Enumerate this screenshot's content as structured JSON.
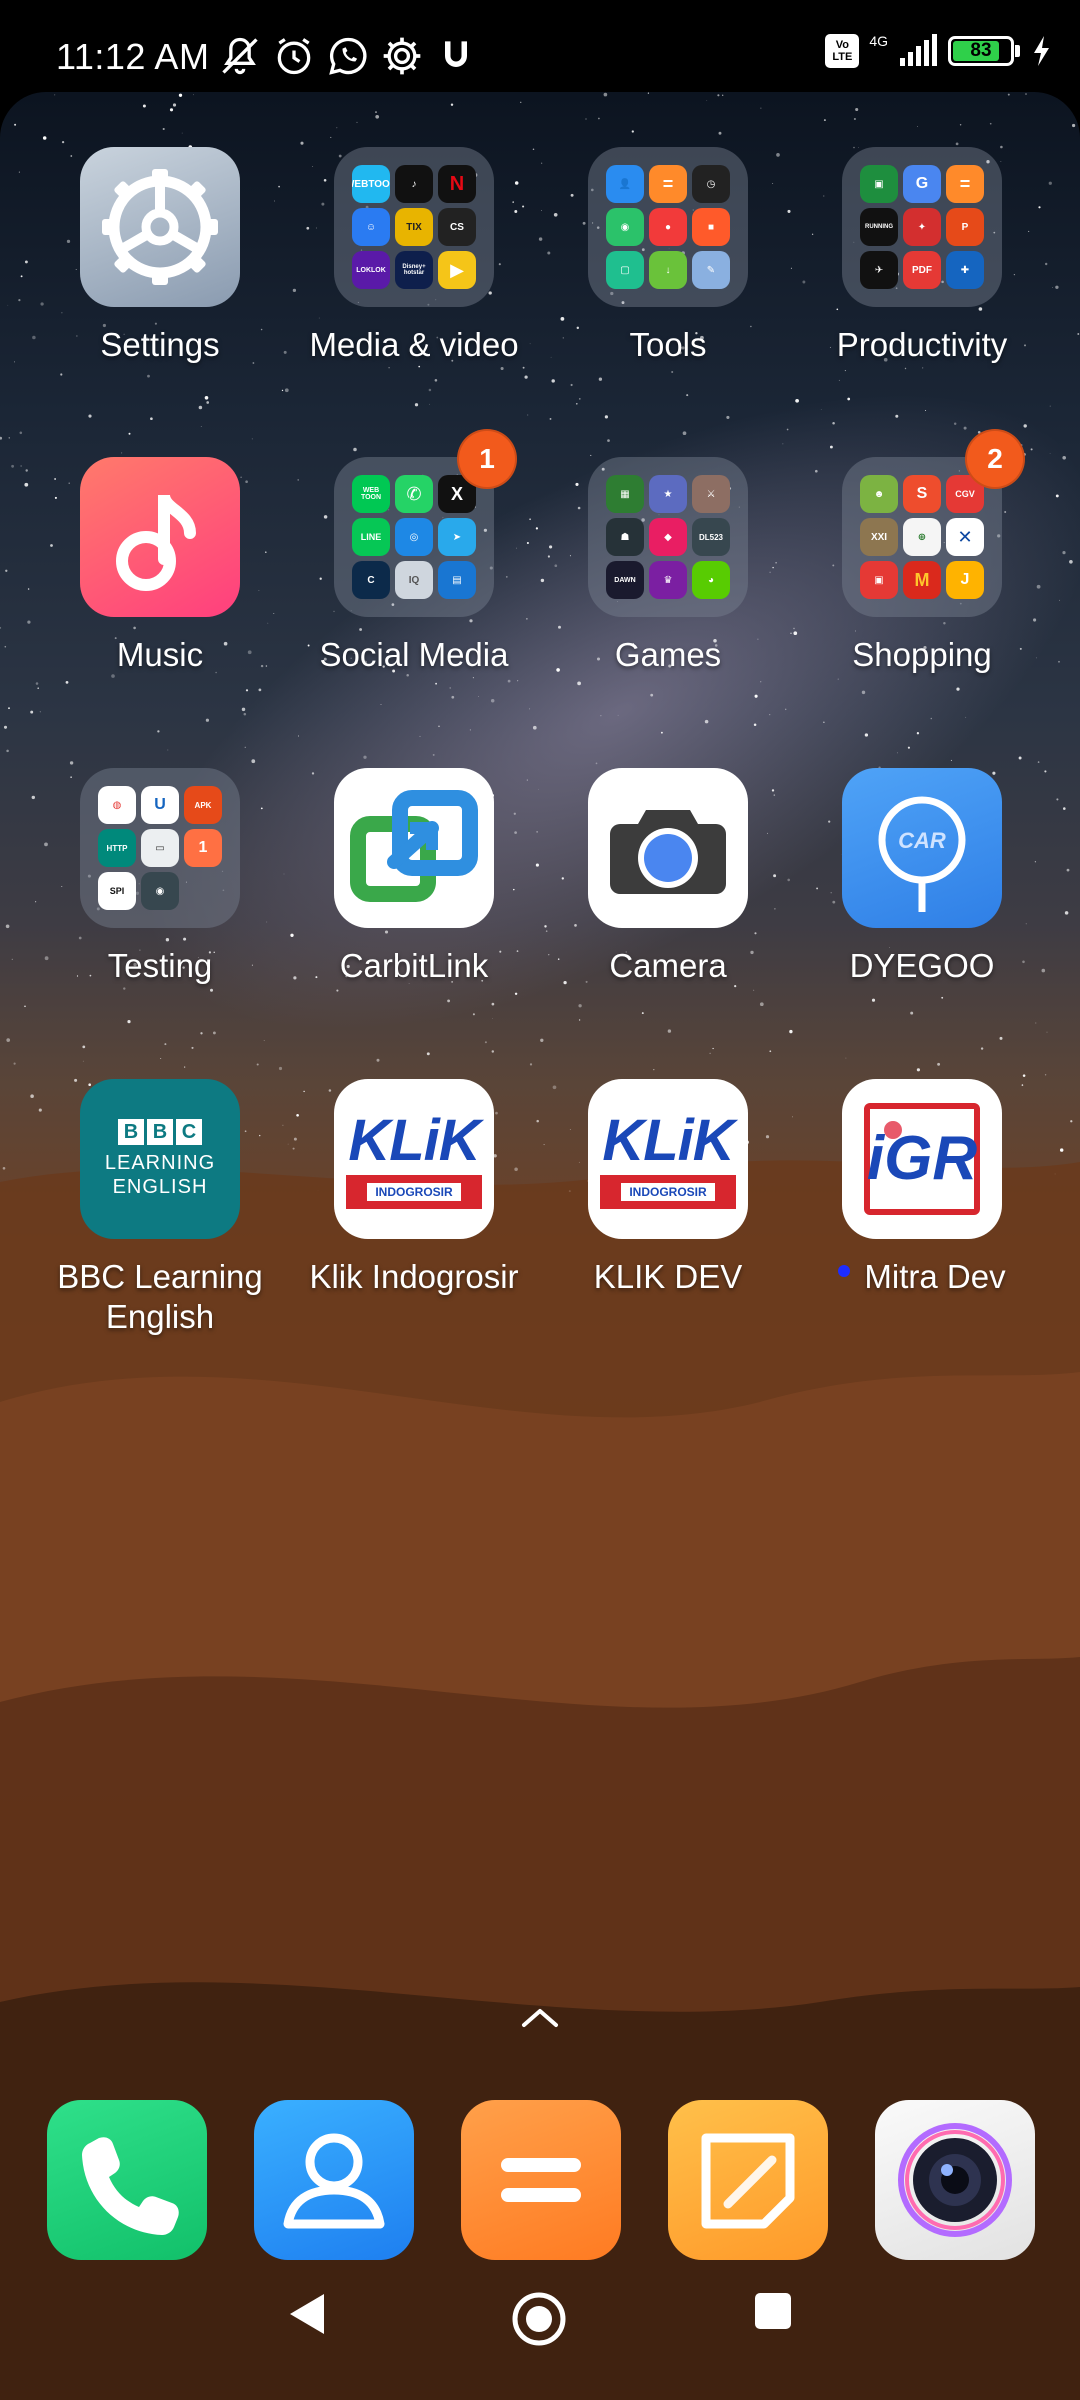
{
  "status_bar": {
    "time": "11:12 AM",
    "volte_line1": "Vo",
    "volte_line2": "LTE",
    "network": "4G",
    "battery_level": "83",
    "icons": [
      "mute-bell-icon",
      "alarm-icon",
      "whatsapp-icon",
      "gear-icon",
      "app-j-icon",
      "volte-icon",
      "signal-icon",
      "battery-icon",
      "charging-icon"
    ]
  },
  "home": {
    "row1": [
      {
        "label": "Settings",
        "icon": "settings-gear-icon"
      },
      {
        "label": "Media & video",
        "icon": "folder-icon"
      },
      {
        "label": "Tools",
        "icon": "folder-icon"
      },
      {
        "label": "Productivity",
        "icon": "folder-icon"
      }
    ],
    "row2": [
      {
        "label": "Music",
        "icon": "music-note-icon"
      },
      {
        "label": "Social Media",
        "icon": "folder-icon",
        "badge": "1"
      },
      {
        "label": "Games",
        "icon": "folder-icon"
      },
      {
        "label": "Shopping",
        "icon": "folder-icon",
        "badge": "2"
      }
    ],
    "row3": [
      {
        "label": "Testing",
        "icon": "folder-icon"
      },
      {
        "label": "CarbitLink",
        "icon": "carbitlink-icon"
      },
      {
        "label": "Camera",
        "icon": "camera-icon"
      },
      {
        "label": "DYEGOO",
        "icon": "dyegoo-icon",
        "icon_text": "CAR"
      }
    ],
    "row4": [
      {
        "label": "BBC Learning English",
        "icon": "bbc-icon",
        "icon_lines": [
          "BBC",
          "LEARNING",
          "ENGLISH"
        ]
      },
      {
        "label": "Klik Indogrosir",
        "icon": "klik-icon",
        "icon_text": "KLiK",
        "icon_sub": "INDOGROSIR"
      },
      {
        "label": "KLIK DEV",
        "icon": "klik-icon",
        "icon_text": "KLiK",
        "icon_sub": "INDOGROSIR"
      },
      {
        "label": "Mitra Dev",
        "icon": "igr-icon",
        "icon_text": "iGR",
        "new_dot": true
      }
    ]
  },
  "folder_minis": {
    "media": [
      "WEBTOON",
      "",
      "N",
      "",
      "TIX",
      "CS",
      "LOKLOK",
      "Disney+ hotstar",
      ""
    ],
    "productivity": [
      "",
      "G",
      "",
      "RUNNING",
      "",
      "",
      "",
      "PDF",
      ""
    ],
    "social": [
      "WEB TOON",
      "",
      "X",
      "LINE",
      "",
      "",
      "",
      "IQ",
      ""
    ],
    "games": [
      "",
      "",
      "",
      "",
      "",
      "DL523",
      "DAWN",
      "",
      ""
    ],
    "shopping": [
      "",
      "S",
      "CGV",
      "XXI",
      "",
      "",
      "",
      "M",
      "J"
    ],
    "testing": [
      "",
      "U",
      "APK",
      "HTTP",
      "",
      "1",
      "SPI",
      "",
      ""
    ]
  },
  "dock": [
    {
      "name": "phone",
      "icon": "phone-icon"
    },
    {
      "name": "contacts",
      "icon": "contacts-icon"
    },
    {
      "name": "file-manager",
      "icon": "equals-icon"
    },
    {
      "name": "notes",
      "icon": "notes-icon"
    },
    {
      "name": "selfie-camera",
      "icon": "lens-icon"
    }
  ],
  "colors": {
    "badge": "#f25a1c",
    "battery_fill": "#2fd04a",
    "music_gradient": [
      "#ff7a6b",
      "#ff3f7e"
    ],
    "bbc_teal": "#0d7a82",
    "dyegoo_blue": "#3b8df0"
  }
}
